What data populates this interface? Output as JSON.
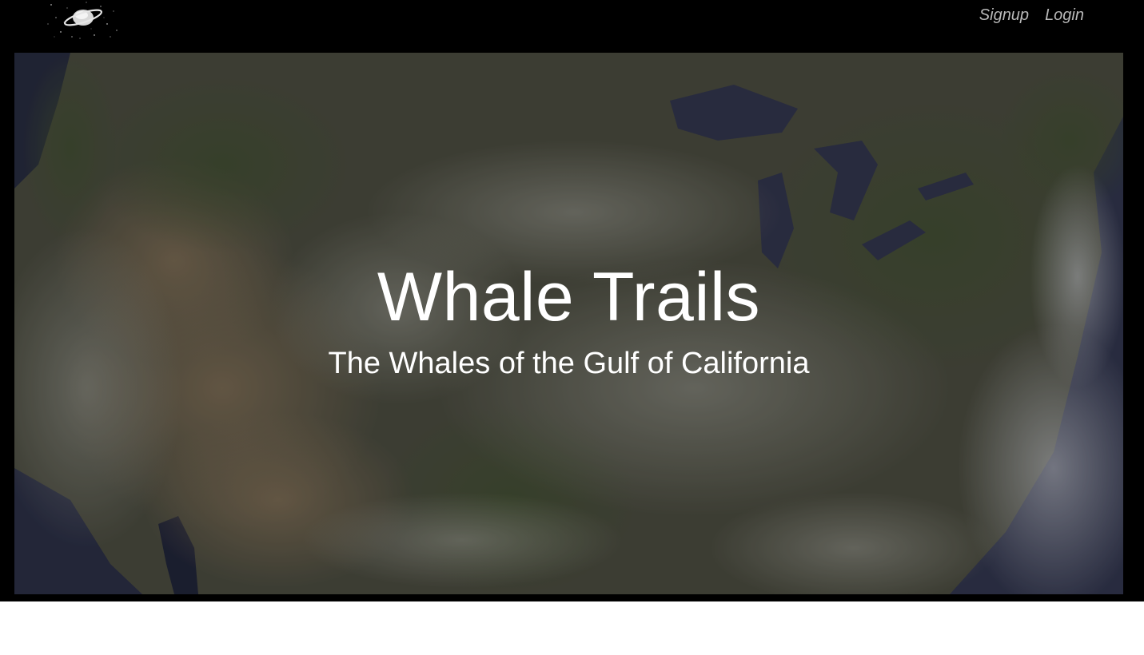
{
  "nav": {
    "logo_icon": "saturn-planet-icon",
    "links": [
      {
        "label": "Signup"
      },
      {
        "label": "Login"
      }
    ]
  },
  "hero": {
    "background_image": "satellite-map-north-america",
    "title": "Whale Trails",
    "subtitle": "The Whales of the Gulf of California"
  },
  "colors": {
    "background": "#000000",
    "nav_link": "#b8b8b8",
    "hero_text": "#ffffff",
    "page": "#ffffff"
  }
}
